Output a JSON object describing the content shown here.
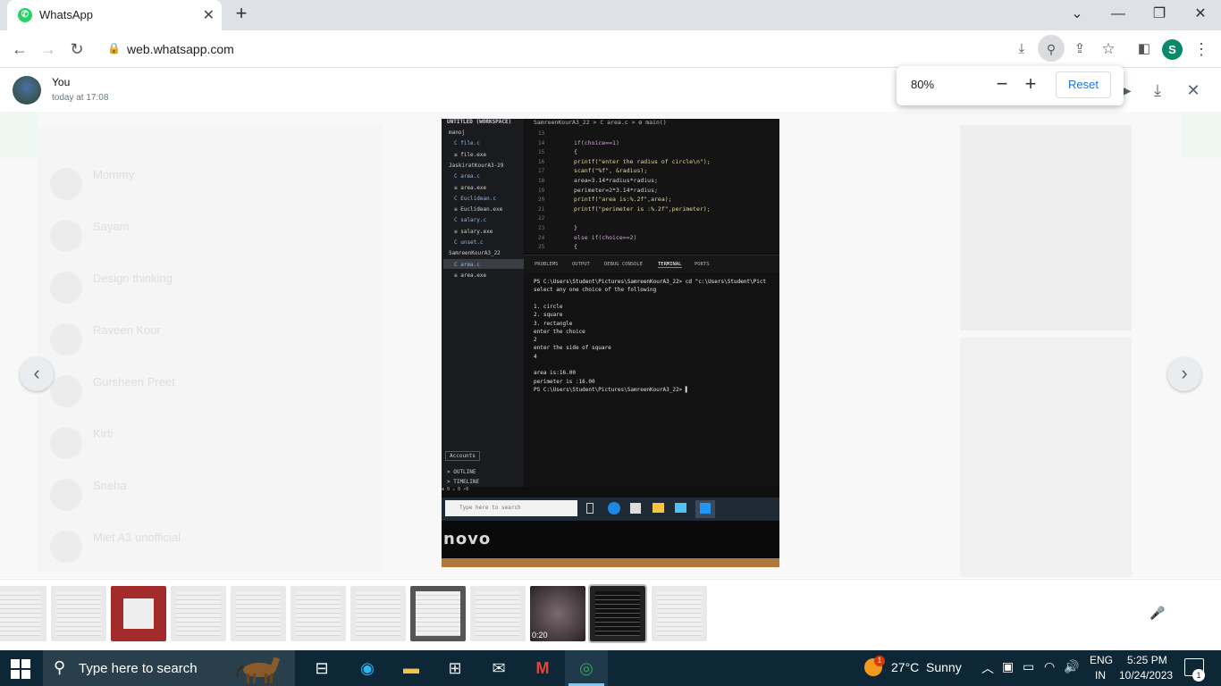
{
  "browser": {
    "tab_title": "WhatsApp",
    "url": "web.whatsapp.com",
    "profile_initial": "S",
    "zoom": {
      "value": "80%",
      "minus": "−",
      "plus": "+",
      "reset_label": "Reset"
    }
  },
  "viewer": {
    "sender": "You",
    "time": "today at 17:08",
    "prev_label": "‹",
    "next_label": "›",
    "video_duration": "0:20",
    "chats_background": [
      {
        "name": "Mommy",
        "msg": ""
      },
      {
        "name": "Sayam",
        "msg": ""
      },
      {
        "name": "Design thinking",
        "msg": ""
      },
      {
        "name": "Raveen Kour",
        "msg": ""
      },
      {
        "name": "Gursheen Preet",
        "msg": ""
      },
      {
        "name": "Kirti",
        "msg": ""
      },
      {
        "name": "Sneha",
        "msg": ""
      },
      {
        "name": "Miet A3 unofficial",
        "msg": ""
      }
    ]
  },
  "photo": {
    "breadcrumb": "SamreenKourA3_22 > C area.c > ⚙ main()",
    "workspace": "UNTITLED (WORKSPACE)",
    "explorer": [
      "manoj",
      "C file.c",
      "≡ file.exe",
      "JaskiratKourA3-29",
      "C area.c",
      "≡ area.exe",
      "C Euclidean.c",
      "≡ Euclidean.exe",
      "C salary.c",
      "≡ salary.exe",
      "C unset.c",
      "SamreenKourA3_22",
      "C area.c",
      "≡ area.exe"
    ],
    "accounts": "Accounts",
    "outline": "> OUTLINE",
    "timeline": "> TIMELINE",
    "line_numbers": [
      "13",
      "14",
      "15",
      "16",
      "17",
      "18",
      "19",
      "20",
      "21",
      "22",
      "23",
      "24",
      "25"
    ],
    "code": [
      "",
      "if(choice==1)",
      "{",
      "  printf(\"enter the radius of circle\\n\");",
      "  scanf(\"%f\", &radius);",
      "  area=3.14*radius*radius;",
      "  perimeter=2*3.14*radius;",
      "  printf(\"area is:%.2f\",area);",
      "  printf(\"perimeter is :%.2f\",perimeter);",
      "",
      "}",
      "   else if(choice==2)",
      "   {"
    ],
    "panel_tabs": [
      "PROBLEMS",
      "OUTPUT",
      "DEBUG CONSOLE",
      "TERMINAL",
      "PORTS"
    ],
    "terminal": [
      "PS C:\\Users\\Student\\Pictures\\SamreenKourA3_22> cd \"c:\\Users\\Student\\Pict",
      "select any one choice of the following",
      "",
      " 1. circle",
      " 2. square",
      " 3. rectangle",
      " enter the choice",
      "2",
      "enter the side of square",
      "4",
      "",
      "area is:16.00",
      "perimeter is :16.00",
      "PS C:\\Users\\Student\\Pictures\\SamreenKourA3_22> ▌"
    ],
    "status": "⊗ 0 ⚠ 0   ⚡0",
    "search_placeholder": "Type here to search",
    "brand": "novo"
  },
  "taskbar": {
    "search_placeholder": "Type here to search",
    "weather_badge": "1",
    "temperature": "27°C",
    "condition": "Sunny",
    "lang_top": "ENG",
    "lang_bottom": "IN",
    "time": "5:25 PM",
    "date": "10/24/2023",
    "notification_count": "1"
  }
}
